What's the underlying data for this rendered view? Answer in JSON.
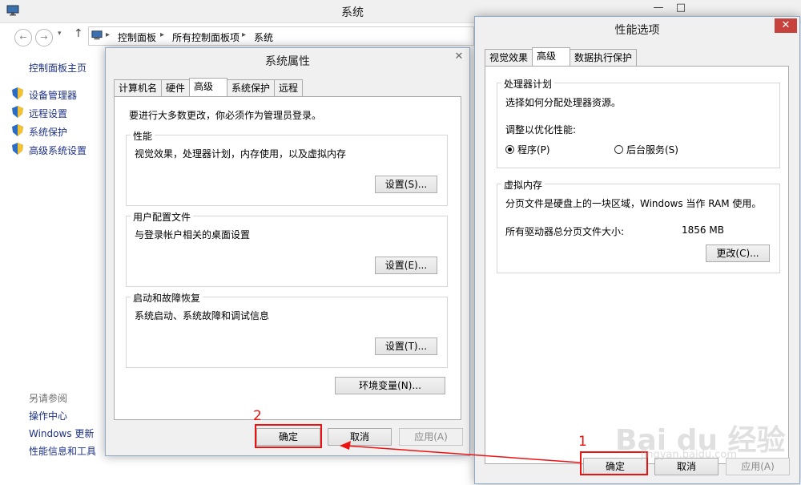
{
  "window": {
    "title": "系统"
  },
  "address": {
    "crumbs": [
      "控制面板",
      "所有控制面板项",
      "系统"
    ]
  },
  "sidebar": {
    "home": "控制面板主页",
    "items": [
      "设备管理器",
      "远程设置",
      "系统保护",
      "高级系统设置"
    ],
    "see_also_title": "另请参阅",
    "see_also": [
      "操作中心",
      "Windows 更新",
      "性能信息和工具"
    ]
  },
  "sysprops": {
    "title": "系统属性",
    "tabs": [
      "计算机名",
      "硬件",
      "高级",
      "系统保护",
      "远程"
    ],
    "active_tab": "高级",
    "admin_note": "要进行大多数更改，你必须作为管理员登录。",
    "perf": {
      "title": "性能",
      "desc": "视觉效果，处理器计划，内存使用，以及虚拟内存",
      "button": "设置(S)..."
    },
    "profile": {
      "title": "用户配置文件",
      "desc": "与登录帐户相关的桌面设置",
      "button": "设置(E)..."
    },
    "startup": {
      "title": "启动和故障恢复",
      "desc": "系统启动、系统故障和调试信息",
      "button": "设置(T)..."
    },
    "env_button": "环境变量(N)...",
    "ok": "确定",
    "cancel": "取消",
    "apply": "应用(A)"
  },
  "perfopts": {
    "title": "性能选项",
    "tabs": [
      "视觉效果",
      "高级",
      "数据执行保护"
    ],
    "active_tab": "高级",
    "sched": {
      "title": "处理器计划",
      "desc": "选择如何分配处理器资源。",
      "adjust": "调整以优化性能:",
      "opt_programs": "程序(P)",
      "opt_services": "后台服务(S)",
      "selected": "程序(P)"
    },
    "vmem": {
      "title": "虚拟内存",
      "desc": "分页文件是硬盘上的一块区域，Windows 当作 RAM 使用。",
      "total_label": "所有驱动器总分页文件大小:",
      "total_value": "1856 MB",
      "change_button": "更改(C)..."
    },
    "ok": "确定",
    "cancel": "取消",
    "apply": "应用(A)"
  },
  "annotations": {
    "step1": "1",
    "step2": "2",
    "color": "#ee1111"
  },
  "watermark": {
    "logo": "Bai du 经验",
    "url": "jingyan.baidu.com"
  },
  "colors": {
    "link": "#1e3287",
    "close_red": "#c7423c",
    "dialog_border": "#8fa9c8"
  }
}
